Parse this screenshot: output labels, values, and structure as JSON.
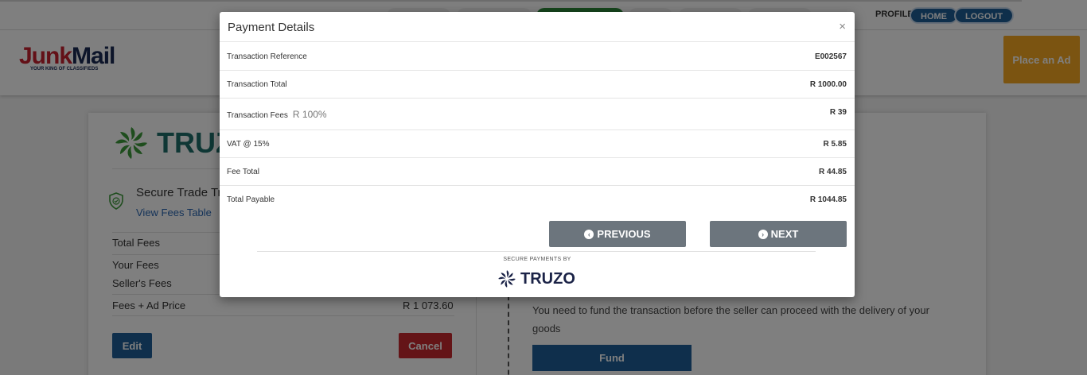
{
  "topbar": {
    "profile_label": "PROFILE",
    "home_label": "HOME",
    "logout_label": "LOGOUT"
  },
  "header": {
    "logo_junk": "Junk",
    "logo_mail": "Mail",
    "logo_tagline": "YOUR KING OF CLASSIFIEDS",
    "place_ad_label": "Place an Ad"
  },
  "card": {
    "brand": "TRUZ",
    "secure_title": "Secure Trade Tr",
    "fees_link": "View Fees Table",
    "rows": [
      {
        "label": "Total Fees",
        "value": ""
      },
      {
        "label": "Your Fees",
        "value": ""
      },
      {
        "label": "Seller's Fees",
        "value": ""
      },
      {
        "label": "Fees + Ad Price",
        "value": "R 1 073.60"
      }
    ],
    "edit_label": "Edit",
    "cancel_label": "Cancel",
    "fund_text": "You need to fund the transaction before the seller can proceed with the delivery of your goods",
    "fund_label": "Fund"
  },
  "modal": {
    "title": "Payment Details",
    "close_glyph": "×",
    "rows": [
      {
        "label": "Transaction Reference",
        "extra": "",
        "value": "E002567"
      },
      {
        "label": "Transaction Total",
        "extra": "",
        "value": "R 1000.00"
      },
      {
        "label": "Transaction Fees",
        "extra": "R 100%",
        "value": "R 39"
      },
      {
        "label": "VAT @ 15%",
        "extra": "",
        "value": "R 5.85"
      },
      {
        "label": "Fee Total",
        "extra": "",
        "value": "R 44.85"
      },
      {
        "label": "Total Payable",
        "extra": "",
        "value": "R 1044.85"
      }
    ],
    "previous_label": "PREVIOUS",
    "next_label": "NEXT",
    "secure_by": "SECURE PAYMENTS BY",
    "truzo_label": "TRUZO"
  },
  "colors": {
    "primary_blue": "#1e5f98",
    "danger_red": "#c8282e",
    "accent_orange": "#f7a823",
    "nav_grey": "#6c757d",
    "truzo_green": "#3c9a3b"
  }
}
